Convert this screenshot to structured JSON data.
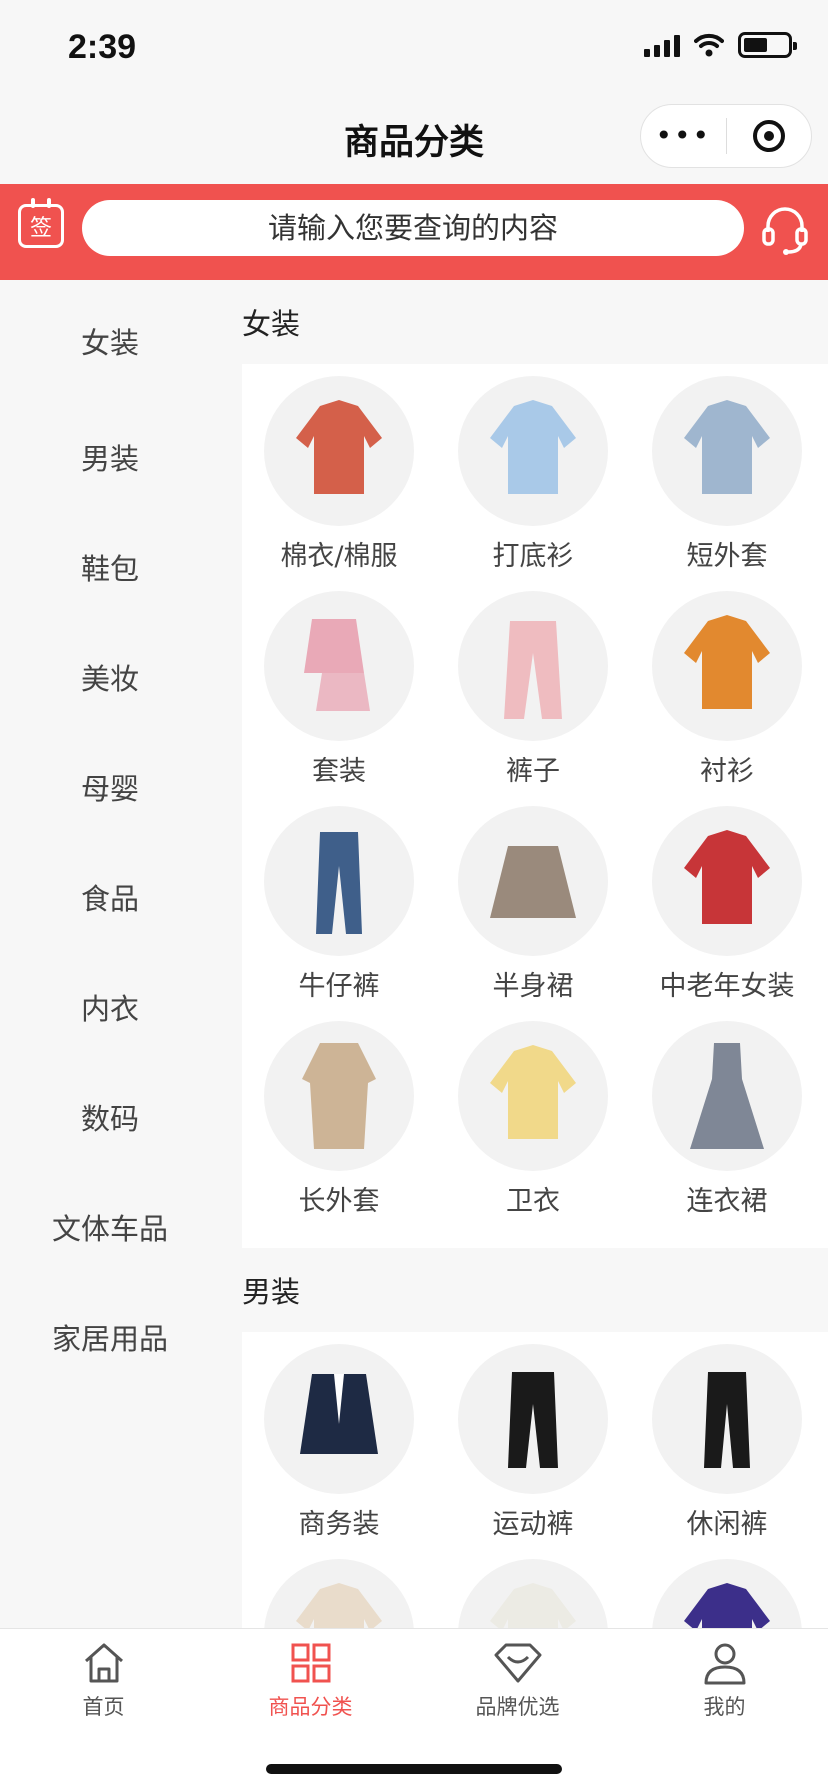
{
  "status": {
    "time": "2:39"
  },
  "nav": {
    "title": "商品分类",
    "more": "•••"
  },
  "search": {
    "placeholder": "请输入您要查询的内容",
    "signin_label": "签"
  },
  "sidebar": {
    "items": [
      "女装",
      "男装",
      "鞋包",
      "美妆",
      "母婴",
      "食品",
      "内衣",
      "数码",
      "文体车品",
      "家居用品"
    ]
  },
  "sections": [
    {
      "title": "女装",
      "items": [
        {
          "label": "棉衣/棉服",
          "icon": "padded-jacket",
          "color": "#d4604a"
        },
        {
          "label": "打底衫",
          "icon": "shirt",
          "color": "#a9c9e8"
        },
        {
          "label": "短外套",
          "icon": "denim-jacket",
          "color": "#9fb6cf"
        },
        {
          "label": "套装",
          "icon": "skirt-set",
          "color": "#e9a9b7"
        },
        {
          "label": "裤子",
          "icon": "pants",
          "color": "#efbcc0"
        },
        {
          "label": "衬衫",
          "icon": "blouse",
          "color": "#e2892f"
        },
        {
          "label": "牛仔裤",
          "icon": "jeans",
          "color": "#3f5f8a"
        },
        {
          "label": "半身裙",
          "icon": "skirt",
          "color": "#9a8a7c"
        },
        {
          "label": "中老年女装",
          "icon": "puffer-coat",
          "color": "#c73538"
        },
        {
          "label": "长外套",
          "icon": "trench-coat",
          "color": "#cdb496"
        },
        {
          "label": "卫衣",
          "icon": "hoodie",
          "color": "#f1d98a"
        },
        {
          "label": "连衣裙",
          "icon": "dress",
          "color": "#7f8796"
        }
      ]
    },
    {
      "title": "男装",
      "items": [
        {
          "label": "商务装",
          "icon": "suit",
          "color": "#1e2a44"
        },
        {
          "label": "运动裤",
          "icon": "sweatpants",
          "color": "#1a1a1a"
        },
        {
          "label": "休闲裤",
          "icon": "jogger",
          "color": "#1a1a1a"
        },
        {
          "label": "",
          "icon": "sweater",
          "color": "#e9dccb"
        },
        {
          "label": "",
          "icon": "jacket",
          "color": "#ecebe4"
        },
        {
          "label": "",
          "icon": "polo",
          "color": "#3c2f8a"
        }
      ]
    }
  ],
  "tabbar": {
    "items": [
      "首页",
      "商品分类",
      "品牌优选",
      "我的"
    ],
    "active_index": 1
  },
  "colors": {
    "accent": "#f0524f",
    "background": "#f7f7f7"
  }
}
